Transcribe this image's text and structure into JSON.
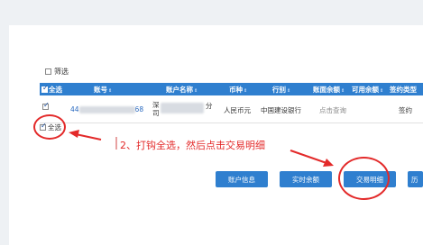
{
  "filter": {
    "label": "筛选",
    "checked": false
  },
  "table": {
    "headers": [
      {
        "label": "全选",
        "checkbox": true
      },
      {
        "label": "账号"
      },
      {
        "label": "账户名称"
      },
      {
        "label": "币种"
      },
      {
        "label": "行别"
      },
      {
        "label": "账面余额"
      },
      {
        "label": "可用余额"
      },
      {
        "label": "签约类型"
      }
    ],
    "rows": [
      {
        "account_prefix": "44",
        "account_suffix": "68",
        "name_line1": "深",
        "name_line2": "司",
        "name_suffix": "分",
        "currency": "人民币元",
        "bank": "中国建设银行",
        "balance": "点击查询",
        "available": "",
        "sign_type": "签约"
      }
    ]
  },
  "select_all_label": "全选",
  "annotation": "2、打钩全选，然后点击交易明细",
  "buttons": {
    "account_info": "账户信息",
    "realtime_balance": "实时余额",
    "transaction_details": "交易明细",
    "history": "历"
  },
  "colors": {
    "header_blue": "#2f7fcf",
    "annotation_red": "#e32a2a"
  }
}
